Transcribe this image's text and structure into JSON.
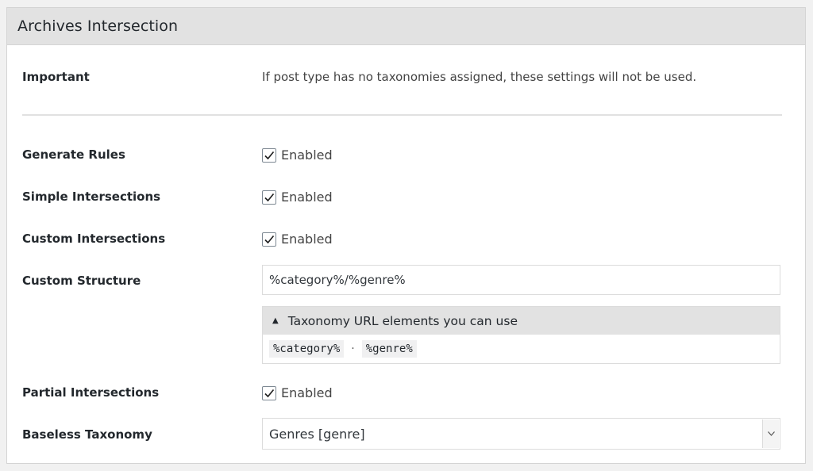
{
  "panel": {
    "title": "Archives Intersection"
  },
  "important": {
    "label": "Important",
    "text": "If post type has no taxonomies assigned, these settings will not be used."
  },
  "generate_rules": {
    "label": "Generate Rules",
    "checkbox_label": "Enabled",
    "checked": true
  },
  "simple_intersections": {
    "label": "Simple Intersections",
    "checkbox_label": "Enabled",
    "checked": true
  },
  "custom_intersections": {
    "label": "Custom Intersections",
    "checkbox_label": "Enabled",
    "checked": true
  },
  "custom_structure": {
    "label": "Custom Structure",
    "value": "%category%/%genre%"
  },
  "taxonomy_elements": {
    "toggle_label": "Taxonomy URL elements you can use",
    "toggle_icon": "triangle-up-icon",
    "elements": [
      "%category%",
      "%genre%"
    ],
    "separator": "·"
  },
  "partial_intersections": {
    "label": "Partial Intersections",
    "checkbox_label": "Enabled",
    "checked": true
  },
  "baseless_taxonomy": {
    "label": "Baseless Taxonomy",
    "selected": "Genres [genre]"
  },
  "colors": {
    "header_bg": "#e2e2e2",
    "panel_bg": "#ffffff",
    "page_bg": "#f1f1f1",
    "text": "#23282d"
  }
}
